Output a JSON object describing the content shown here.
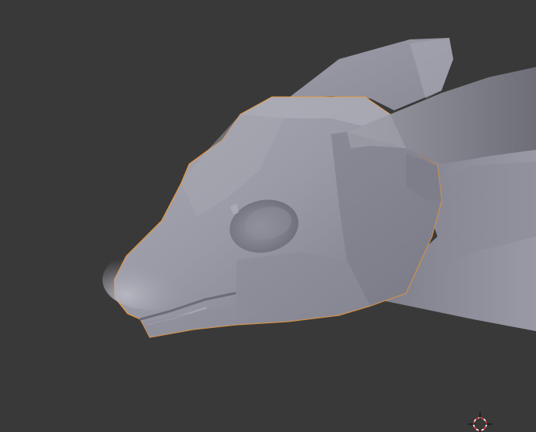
{
  "viewport": {
    "background": "#393939",
    "selection_outline_color": "#e8963a",
    "mesh_base_color": "#8e8e99",
    "mesh_light_color": "#b4b4be",
    "mesh_shadow_color": "#5e5e68",
    "selected_object": "rodent-head-mesh",
    "cursor_icon": "3d-cursor-icon"
  }
}
